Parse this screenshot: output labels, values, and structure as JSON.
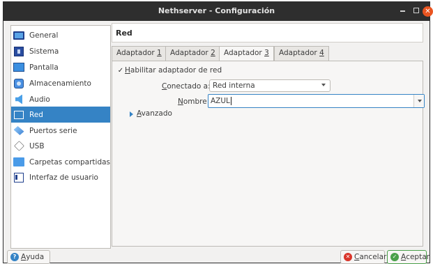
{
  "window": {
    "title": "Nethserver - Configuración",
    "close_glyph": "✕"
  },
  "sidebar": {
    "items": [
      {
        "label": "General",
        "icon": "monitor-icon"
      },
      {
        "label": "Sistema",
        "icon": "chip-icon"
      },
      {
        "label": "Pantalla",
        "icon": "display-icon"
      },
      {
        "label": "Almacenamiento",
        "icon": "storage-icon"
      },
      {
        "label": "Audio",
        "icon": "audio-icon"
      },
      {
        "label": "Red",
        "icon": "network-icon",
        "selected": true
      },
      {
        "label": "Puertos serie",
        "icon": "serial-ports-icon"
      },
      {
        "label": "USB",
        "icon": "usb-icon"
      },
      {
        "label": "Carpetas compartidas",
        "icon": "shared-folders-icon"
      },
      {
        "label": "Interfaz de usuario",
        "icon": "user-interface-icon"
      }
    ]
  },
  "main": {
    "title": "Red",
    "tabs": [
      {
        "label": "Adaptador ",
        "key": "1",
        "active": false
      },
      {
        "label": "Adaptador ",
        "key": "2",
        "active": false
      },
      {
        "label": "Adaptador ",
        "key": "3",
        "active": true
      },
      {
        "label": "Adaptador ",
        "key": "4",
        "active": false
      }
    ],
    "enable_adapter": {
      "checked": true,
      "check_glyph": "✓",
      "key": "H",
      "label_rest": "abilitar adaptador de red"
    },
    "attached_to": {
      "key": "C",
      "label_rest": "onectado a:",
      "value": "Red interna"
    },
    "name": {
      "key": "N",
      "label_rest": "ombre:",
      "value": "AZUL"
    },
    "advanced": {
      "key": "A",
      "label_rest": "vanzado"
    }
  },
  "buttons": {
    "help": {
      "key": "A",
      "rest": "yuda",
      "icon_glyph": "?"
    },
    "cancel": {
      "key": "C",
      "rest": "ancelar",
      "icon_glyph": "✕"
    },
    "accept": {
      "key": "A",
      "rest": "ceptar",
      "icon_glyph": "✓"
    }
  },
  "colors": {
    "accent": "#3583c5",
    "titlebar": "#2e2e2e",
    "close": "#e95420",
    "help_icon": "#3583c5",
    "cancel_icon": "#d9352a",
    "accept_icon": "#4aa04a"
  }
}
